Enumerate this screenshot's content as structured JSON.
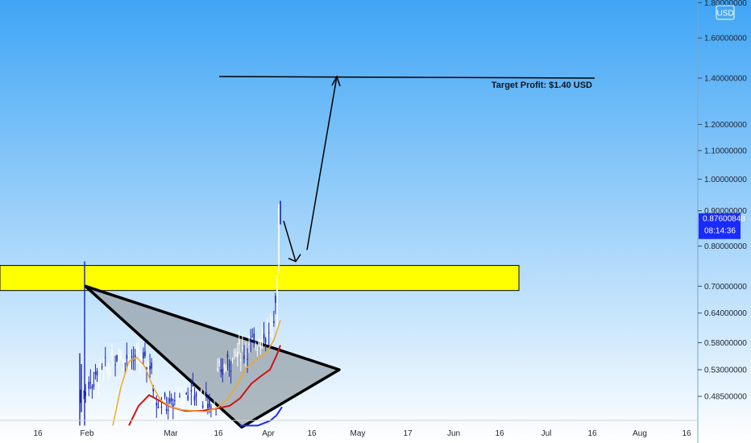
{
  "chart_data": {
    "type": "candlestick",
    "currency_badge": "USD",
    "y_scale": "log",
    "ylim": [
      0.44,
      1.83
    ],
    "price_ticks": [
      "1.80000000",
      "1.60000000",
      "1.40000000",
      "1.20000000",
      "1.10000000",
      "1.00000000",
      "0.90000000",
      "0.80000000",
      "0.70000000",
      "0.64000000",
      "0.58000000",
      "0.53000000",
      "0.48500000"
    ],
    "price_tick_values": [
      1.8,
      1.6,
      1.4,
      1.2,
      1.1,
      1.0,
      0.9,
      0.8,
      0.7,
      0.64,
      0.58,
      0.53,
      0.485
    ],
    "date_labels": [
      "16",
      "Feb",
      "Mar",
      "16",
      "Apr",
      "16",
      "May",
      "17",
      "Jun",
      "16",
      "Jul",
      "16",
      "Aug",
      "16"
    ],
    "current_price": {
      "value": 0.876,
      "label": "0.87600848",
      "countdown": "08:14:36"
    },
    "target_line": {
      "price": 1.4,
      "label": "Target Profit: $1.40 USD"
    },
    "support_zone": {
      "low": 0.69,
      "high": 0.75,
      "color": "#ffff00"
    },
    "triangle": {
      "apex_price": 0.53,
      "top_start_price": 0.7,
      "bottom_start_price": 0.44
    },
    "colors": {
      "sky_top": "#3fa5f5",
      "sky_bottom": "#ffffff",
      "candle_up": "#ffffff",
      "candle_down": "#1a26b8",
      "ma_fast": "#f5a623",
      "ma_slow": "#cc1616",
      "ma_long": "#1a2bff",
      "badge": "#1a2bff"
    }
  }
}
